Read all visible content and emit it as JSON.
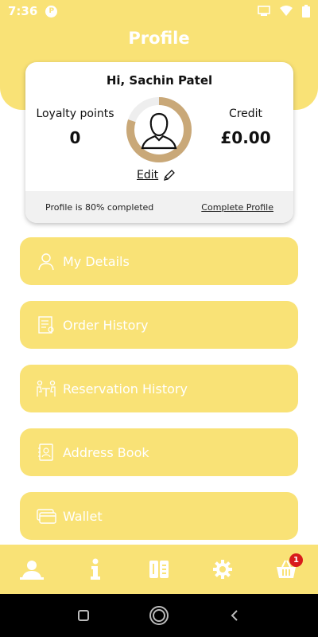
{
  "status_bar": {
    "time": "7:36",
    "app_icon_letter": "P"
  },
  "header": {
    "title": "Profile"
  },
  "profile_card": {
    "greeting": "Hi, Sachin Patel",
    "loyalty_label": "Loyalty points",
    "loyalty_value": "0",
    "credit_label": "Credit",
    "credit_value": "£0.00",
    "edit_label": "Edit",
    "completion_text": "Profile is 80% completed",
    "completion_percent": 80,
    "complete_profile_link": "Complete Profile"
  },
  "menu": [
    {
      "label": "My Details",
      "icon": "user-outline-icon"
    },
    {
      "label": "Order History",
      "icon": "receipt-icon"
    },
    {
      "label": "Reservation History",
      "icon": "table-reservation-icon"
    },
    {
      "label": "Address Book",
      "icon": "address-book-icon"
    },
    {
      "label": "Wallet",
      "icon": "wallet-icon"
    }
  ],
  "bottom_nav": {
    "items": [
      "profile-icon",
      "info-icon",
      "menu-book-icon",
      "settings-icon",
      "basket-icon"
    ],
    "cart_count": "1"
  },
  "colors": {
    "accent": "#f9e276",
    "ring": "#c9a878",
    "badge": "#d81b1b"
  }
}
